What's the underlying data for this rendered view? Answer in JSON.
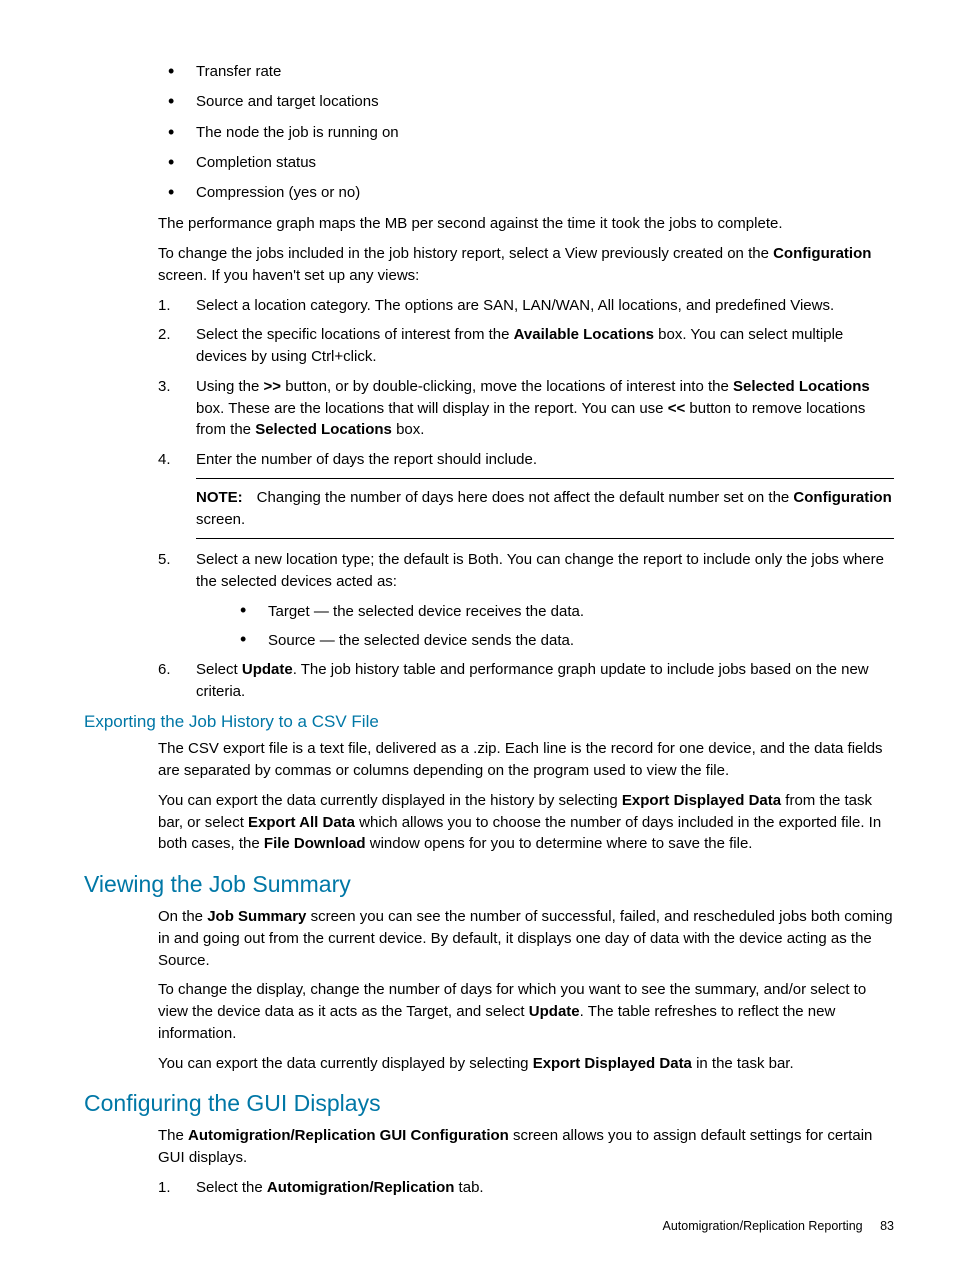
{
  "bullets_top": [
    "Transfer rate",
    "Source and target locations",
    "The node the job is running on",
    "Completion status",
    "Compression (yes or no)"
  ],
  "para_perf": "The performance graph maps the MB per second against the time it took the jobs to complete.",
  "para_change_pre": "To change the jobs included in the job history report, select a View previously created on the ",
  "para_change_bold": "Configuration",
  "para_change_post": " screen. If you haven't set up any views:",
  "step1": "Select a location category. The options are SAN, LAN/WAN, All locations, and predefined Views.",
  "step2_pre": "Select the specific locations of interest from the ",
  "step2_b1": "Available Locations",
  "step2_post": " box. You can select multiple devices by using Ctrl+click.",
  "step3_pre": "Using the ",
  "step3_b1": ">>",
  "step3_mid1": " button, or by double-clicking, move the locations of interest into the ",
  "step3_b2": "Selected Locations",
  "step3_mid2": " box. These are the locations that will display in the report. You can use ",
  "step3_b3": "<<",
  "step3_mid3": " button to remove locations from the ",
  "step3_b4": "Selected Locations",
  "step3_post": " box.",
  "step4": "Enter the number of days the report should include.",
  "note_label": "NOTE:",
  "note_pre": "Changing the number of days here does not affect the default number set on the ",
  "note_b": "Configuration",
  "note_post": " screen.",
  "step5": "Select a new location type; the default is Both. You can change the report to include only the jobs where the selected devices acted as:",
  "step5_sub1": "Target — the selected device receives the data.",
  "step5_sub2": "Source — the selected device sends the data.",
  "step6_pre": "Select ",
  "step6_b": "Update",
  "step6_post": ". The job history table and performance graph update to include jobs based on the new criteria.",
  "h_export": "Exporting the Job History to a CSV File",
  "export_p1": "The CSV export file is a text file, delivered as a .zip. Each line is the record for one device, and the data fields are separated by commas or columns depending on the program used to view the file.",
  "export_p2_pre": "You can export the data currently displayed in the history by selecting ",
  "export_p2_b1": "Export Displayed Data",
  "export_p2_mid1": " from the task bar, or select ",
  "export_p2_b2": "Export All Data",
  "export_p2_mid2": " which allows you to choose the number of days included in the exported file. In both cases, the ",
  "export_p2_b3": "File Download",
  "export_p2_post": " window opens for you to determine where to save the file.",
  "h_summary": "Viewing the Job Summary",
  "summary_p1_pre": "On the ",
  "summary_p1_b": "Job Summary",
  "summary_p1_post": " screen you can see the number of successful, failed, and rescheduled jobs both coming in and going out from the current device. By default, it displays one day of data with the device acting as the Source.",
  "summary_p2_pre": "To change the display, change the number of days for which you want to see the summary, and/or select to view the device data as it acts as the Target, and select ",
  "summary_p2_b": "Update",
  "summary_p2_post": ". The table refreshes to reflect the new information.",
  "summary_p3_pre": "You can export the data currently displayed by selecting ",
  "summary_p3_b": "Export Displayed Data",
  "summary_p3_post": " in the task bar.",
  "h_config": "Configuring the GUI Displays",
  "config_p1_pre": "The ",
  "config_p1_b": "Automigration/Replication GUI Configuration",
  "config_p1_post": " screen allows you to assign default settings for certain GUI displays.",
  "config_step1_pre": "Select the ",
  "config_step1_b": "Automigration/Replication",
  "config_step1_post": " tab.",
  "footer_text": "Automigration/Replication Reporting",
  "footer_page": "83"
}
